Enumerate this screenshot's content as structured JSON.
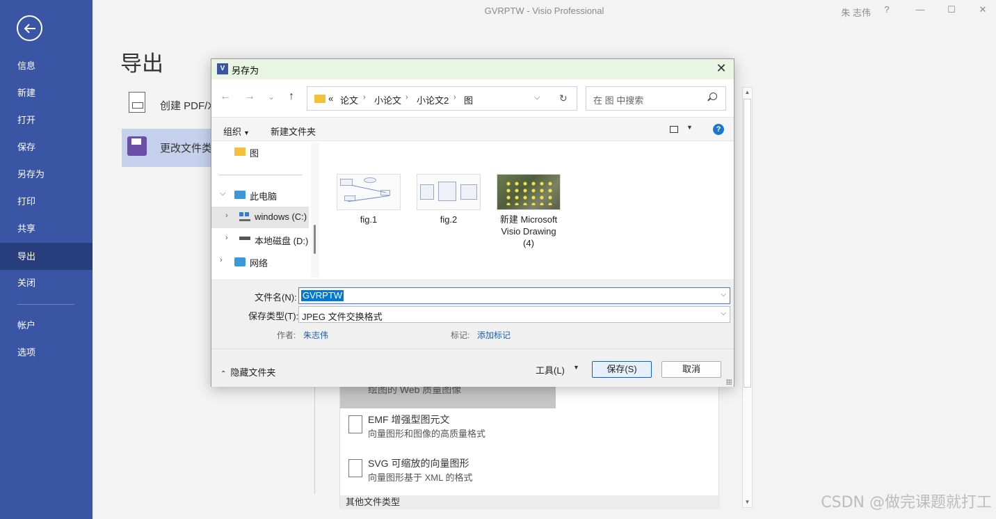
{
  "window": {
    "title": "GVRPTW  -  Visio Professional",
    "user": "朱 志伟",
    "help": "?",
    "minimize": "—",
    "maximize": "☐",
    "close": "✕"
  },
  "backstage_nav": {
    "items": [
      {
        "label": "信息"
      },
      {
        "label": "新建"
      },
      {
        "label": "打开"
      },
      {
        "label": "保存"
      },
      {
        "label": "另存为"
      },
      {
        "label": "打印"
      },
      {
        "label": "共享"
      },
      {
        "label": "导出",
        "active": true
      },
      {
        "label": "关闭"
      },
      {
        "label": "帐户"
      },
      {
        "label": "选项"
      }
    ]
  },
  "export_page": {
    "heading": "导出",
    "options": [
      {
        "label": "创建 PDF/X"
      },
      {
        "label": "更改文件类"
      }
    ],
    "file_types": {
      "highlight_text": "绘图的 Web 质量图像",
      "items": [
        {
          "title": "EMF 增强型图元文",
          "desc": "向量图形和图像的高质量格式"
        },
        {
          "title": "SVG 可缩放的向量图形",
          "desc": "向量图形基于 XML 的格式"
        }
      ],
      "other_label": "其他文件类型"
    }
  },
  "watermark": "CSDN @做完课题就打工",
  "dialog": {
    "title": "另存为",
    "icon_letter": "V",
    "close": "✕",
    "nav": {
      "back": "←",
      "forward": "→",
      "recent": "⌄",
      "up": "↑"
    },
    "breadcrumbs": [
      "论文",
      "小论文",
      "小论文2",
      "图"
    ],
    "breadcrumb_prefix": "«",
    "search_placeholder": "在 图 中搜索",
    "toolbar": {
      "organize": "组织",
      "new_folder": "新建文件夹",
      "help": "?"
    },
    "tree": [
      {
        "label": "图",
        "type": "folder"
      },
      {
        "label": "此电脑",
        "type": "pc",
        "expanded": true
      },
      {
        "label": "windows (C:)",
        "type": "drive",
        "selected": true
      },
      {
        "label": "本地磁盘 (D:)",
        "type": "drive"
      },
      {
        "label": "网络",
        "type": "network"
      }
    ],
    "files": [
      {
        "name": "fig.1",
        "thumb": "diagram"
      },
      {
        "name": "fig.2",
        "thumb": "table"
      },
      {
        "name": "新建 Microsoft Visio Drawing (4)",
        "name_lines": [
          "新建 Microsoft",
          "Visio Drawing",
          "(4)"
        ],
        "thumb": "map"
      }
    ],
    "filename_label": "文件名(N):",
    "filename_value": "GVRPTW",
    "savetype_label": "保存类型(T):",
    "savetype_value": "JPEG 文件交换格式",
    "author_label": "作者:",
    "author_value": "朱志伟",
    "tags_label": "标记:",
    "tags_value": "添加标记",
    "hide_folders": "隐藏文件夹",
    "tools": "工具(L)",
    "save": "保存(S)",
    "cancel": "取消"
  }
}
